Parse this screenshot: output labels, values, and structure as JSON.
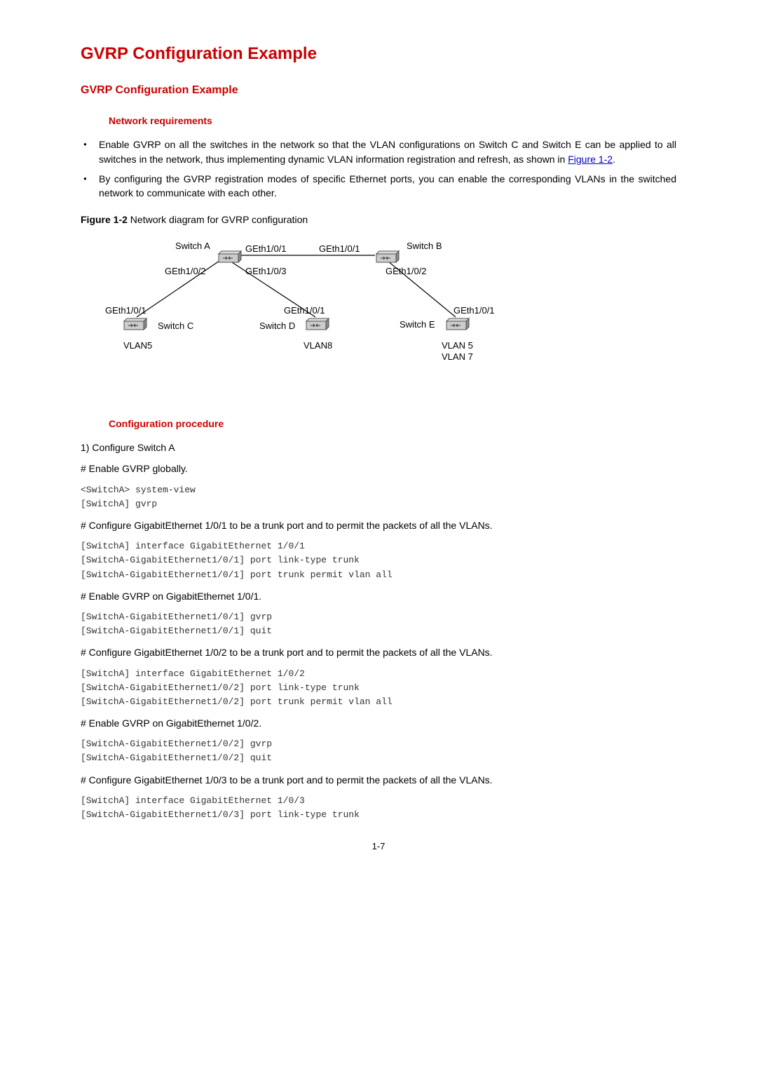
{
  "title": "GVRP Configuration Example",
  "subtitle": "GVRP Configuration Example",
  "netreq_heading": "Network requirements",
  "bullets": [
    {
      "pre": "Enable GVRP on all the switches in the network so that the VLAN configurations on Switch C and Switch E can be applied to all switches in the network, thus implementing dynamic VLAN information registration and refresh, as shown in ",
      "link": "Figure 1-2",
      "post": "."
    },
    {
      "pre": "By configuring the GVRP registration modes of specific Ethernet ports, you can enable the corresponding VLANs in the switched network to communicate with each other.",
      "link": "",
      "post": ""
    }
  ],
  "figure": {
    "label": "Figure 1-2",
    "desc": " Network diagram for GVRP configuration"
  },
  "diagram": {
    "switchA": "Switch A",
    "switchB": "Switch B",
    "switchC": "Switch C",
    "switchD": "Switch D",
    "switchE": "Switch E",
    "ge101": "GEth1/0/1",
    "ge102": "GEth1/0/2",
    "ge103": "GEth1/0/3",
    "vlan5": "VLAN5",
    "vlan7": "VLAN 7",
    "vlan8": "VLAN8",
    "vlan5b": "VLAN 5"
  },
  "proc_heading": "Configuration procedure",
  "step1": "1)    Configure Switch A",
  "p_enable_global": "# Enable GVRP globally.",
  "code_enable_global": "<SwitchA> system-view\n[SwitchA] gvrp",
  "p_cfg_101": "# Configure GigabitEthernet 1/0/1 to be a trunk port and to permit the packets of all the VLANs.",
  "code_cfg_101": "[SwitchA] interface GigabitEthernet 1/0/1\n[SwitchA-GigabitEthernet1/0/1] port link-type trunk\n[SwitchA-GigabitEthernet1/0/1] port trunk permit vlan all",
  "p_en_101": "# Enable GVRP on GigabitEthernet 1/0/1.",
  "code_en_101": "[SwitchA-GigabitEthernet1/0/1] gvrp\n[SwitchA-GigabitEthernet1/0/1] quit",
  "p_cfg_102": "# Configure GigabitEthernet 1/0/2 to be a trunk port and to permit the packets of all the VLANs.",
  "code_cfg_102": "[SwitchA] interface GigabitEthernet 1/0/2\n[SwitchA-GigabitEthernet1/0/2] port link-type trunk\n[SwitchA-GigabitEthernet1/0/2] port trunk permit vlan all",
  "p_en_102": "# Enable GVRP on GigabitEthernet 1/0/2.",
  "code_en_102": "[SwitchA-GigabitEthernet1/0/2] gvrp\n[SwitchA-GigabitEthernet1/0/2] quit",
  "p_cfg_103": "# Configure GigabitEthernet 1/0/3 to be a trunk port and to permit the packets of all the VLANs.",
  "code_cfg_103": "[SwitchA] interface GigabitEthernet 1/0/3\n[SwitchA-GigabitEthernet1/0/3] port link-type trunk",
  "page_number": "1-7"
}
